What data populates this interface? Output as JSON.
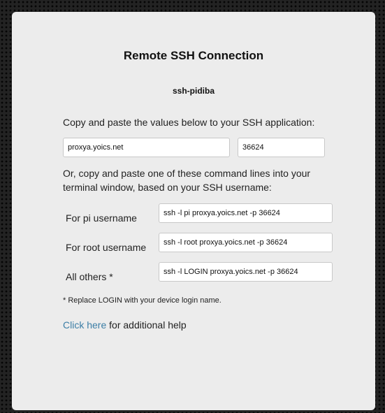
{
  "page": {
    "title": "Remote SSH Connection",
    "device_name": "ssh-pidiba",
    "intro_text": "Copy and paste the values below to your SSH application:",
    "host_value": "proxya.yoics.net",
    "port_value": "36624",
    "command_intro": "Or, copy and paste one of these command lines into your terminal window, based on your SSH username:",
    "commands": [
      {
        "label": "For pi username",
        "value": "ssh -l pi proxya.yoics.net -p 36624"
      },
      {
        "label": "For root username",
        "value": "ssh -l root proxya.yoics.net -p 36624"
      },
      {
        "label": "All others *",
        "value": "ssh -l LOGIN proxya.yoics.net -p 36624"
      }
    ],
    "footnote": "* Replace LOGIN with your device login name.",
    "help_link": "Click here",
    "help_suffix": " for additional help"
  },
  "colors": {
    "background": "#232323",
    "panel": "#ececec",
    "link": "#3c7ea6"
  }
}
